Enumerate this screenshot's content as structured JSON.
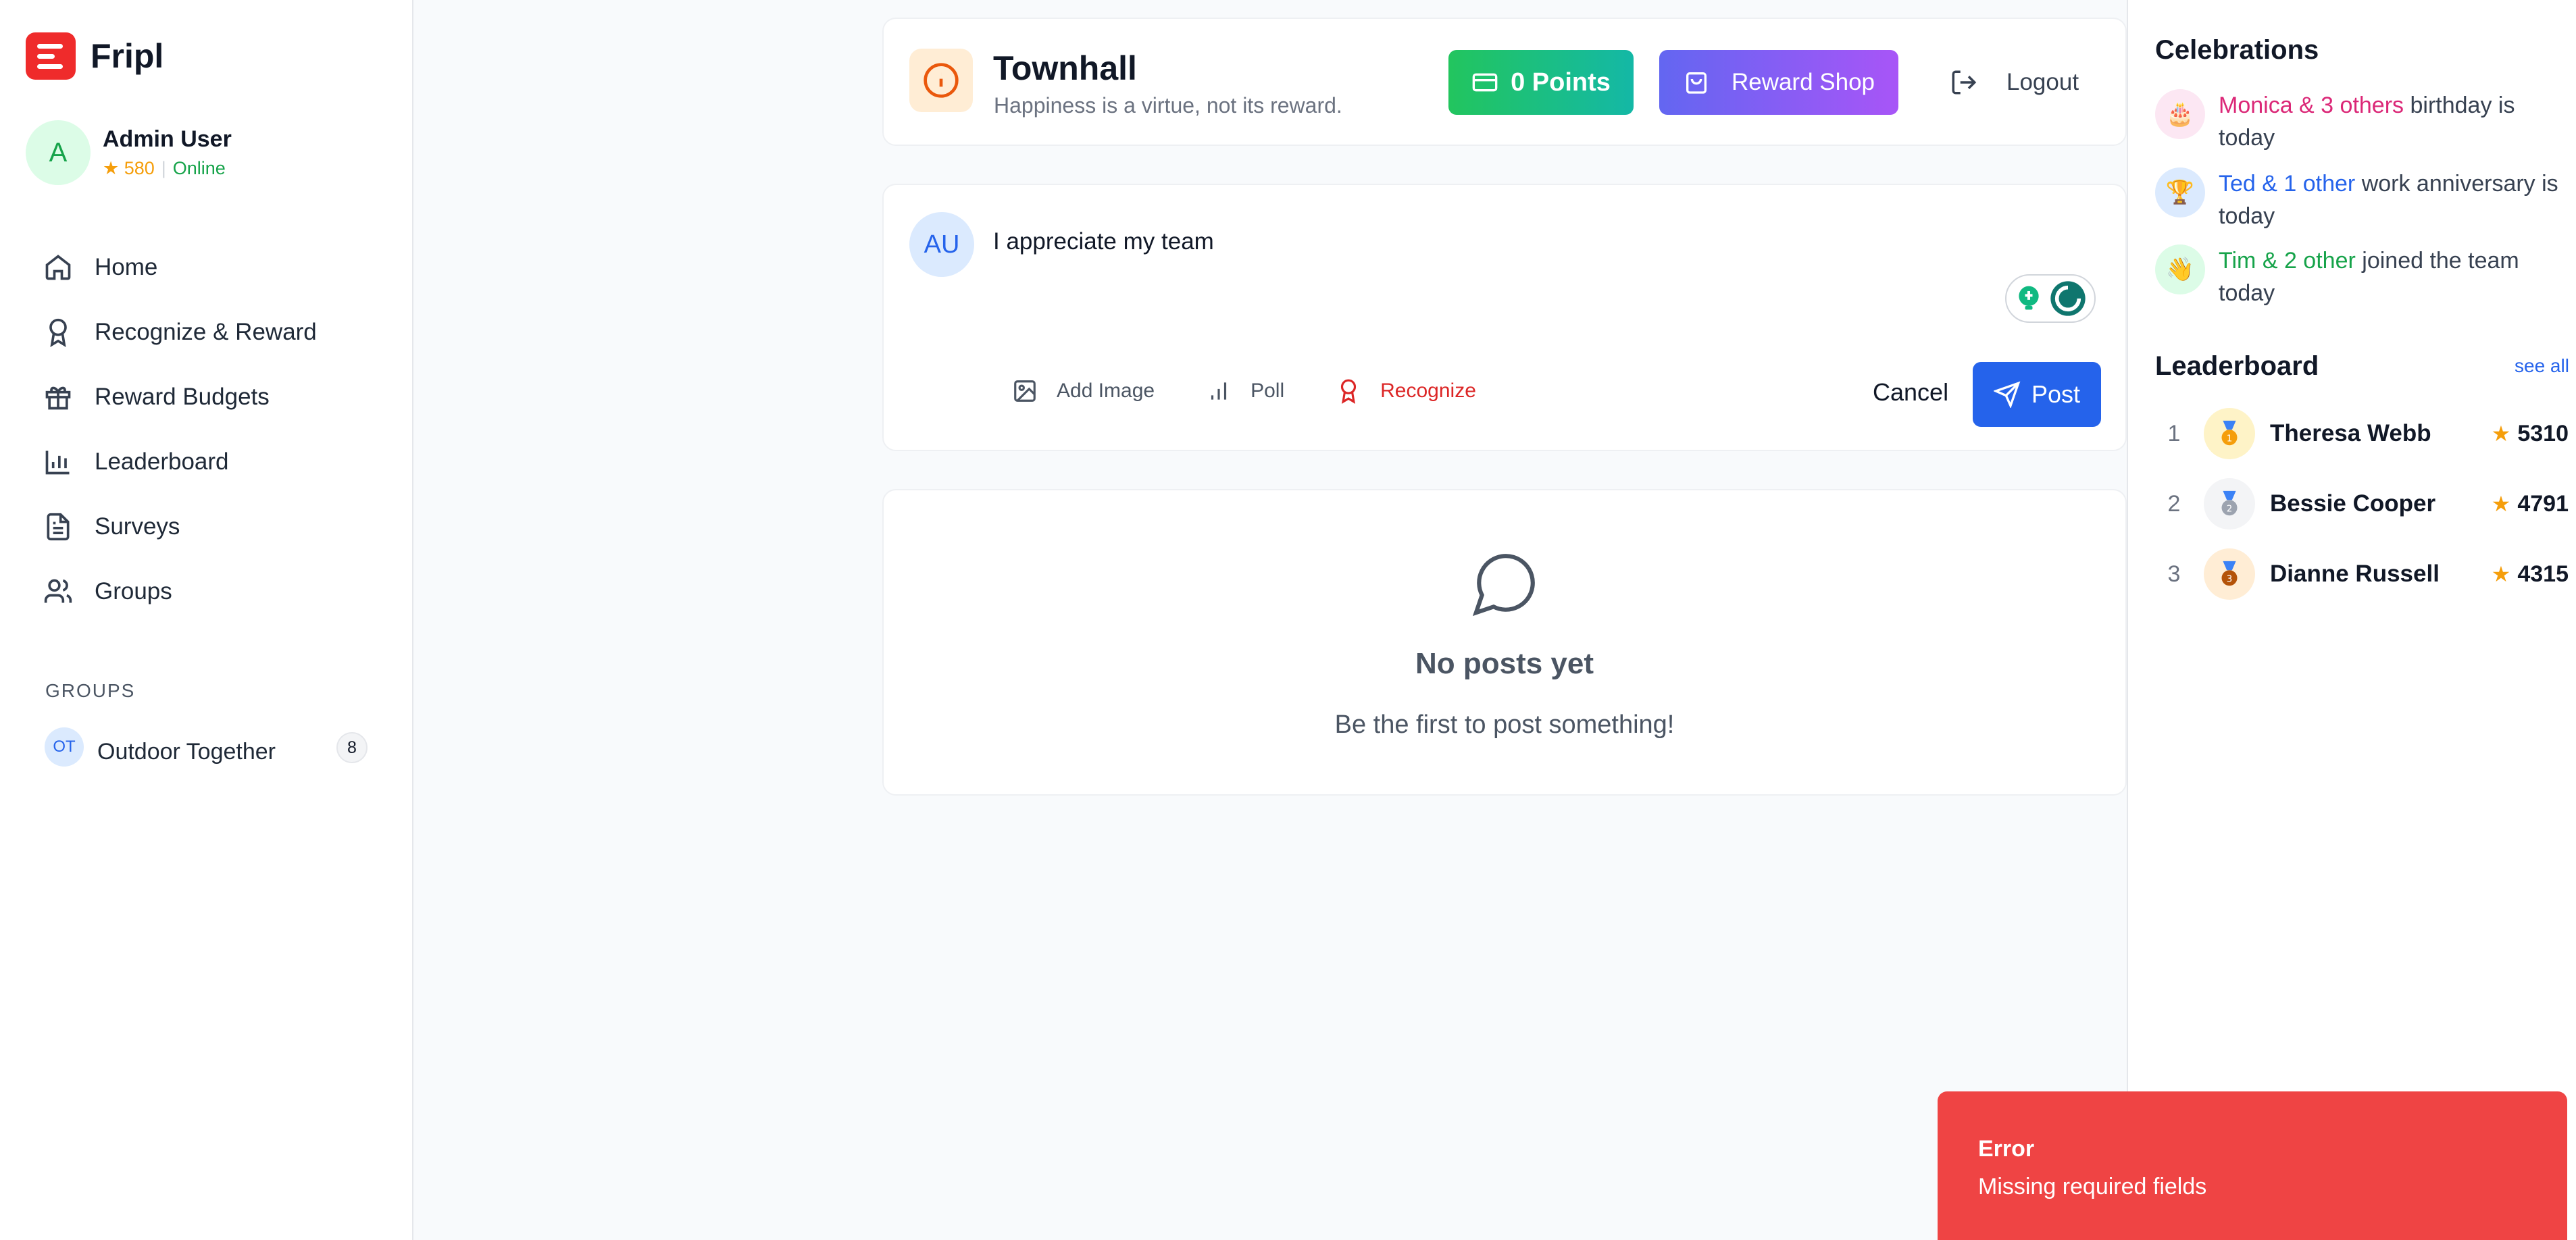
{
  "app": {
    "name": "Fripl"
  },
  "user": {
    "initial": "A",
    "name": "Admin User",
    "points": "★ 580",
    "status": "Online"
  },
  "nav": [
    {
      "label": "Home",
      "icon": "home-icon"
    },
    {
      "label": "Recognize & Reward",
      "icon": "award-icon"
    },
    {
      "label": "Reward Budgets",
      "icon": "gift-icon"
    },
    {
      "label": "Leaderboard",
      "icon": "bar-chart-icon"
    },
    {
      "label": "Surveys",
      "icon": "document-icon"
    },
    {
      "label": "Groups",
      "icon": "users-icon"
    }
  ],
  "groups": {
    "title": "GROUPS",
    "items": [
      {
        "initials": "OT",
        "name": "Outdoor Together",
        "count": "8"
      }
    ]
  },
  "header": {
    "title": "Townhall",
    "subtitle": "Happiness is a virtue, not its reward.",
    "points_label": "0 Points",
    "shop_label": "Reward Shop",
    "logout_label": "Logout"
  },
  "composer": {
    "avatar": "AU",
    "text": "I appreciate my team",
    "actions": {
      "image": "Add Image",
      "poll": "Poll",
      "recognize": "Recognize"
    },
    "cancel": "Cancel",
    "post": "Post"
  },
  "feed": {
    "empty_title": "No posts yet",
    "empty_subtitle": "Be the first to post something!"
  },
  "celebrations": {
    "title": "Celebrations",
    "items": [
      {
        "highlight": "Monica & 3 others",
        "rest": "birthday is today",
        "icon": "cake-icon"
      },
      {
        "highlight": "Ted & 1 other",
        "rest": "work anniversary is today",
        "icon": "trophy-icon"
      },
      {
        "highlight": "Tim & 2 other",
        "rest": "joined the team today",
        "icon": "wave-icon"
      }
    ]
  },
  "leaderboard": {
    "title": "Leaderboard",
    "see_all": "see all",
    "rows": [
      {
        "rank": "1",
        "name": "Theresa Webb",
        "points": "5310",
        "medal": "gold-medal-icon"
      },
      {
        "rank": "2",
        "name": "Bessie Cooper",
        "points": "4791",
        "medal": "silver-medal-icon"
      },
      {
        "rank": "3",
        "name": "Dianne Russell",
        "points": "4315",
        "medal": "bronze-medal-icon"
      }
    ]
  },
  "toast": {
    "title": "Error",
    "message": "Missing required fields"
  },
  "colors": {
    "brand": "#ef2b2b",
    "primary": "#2563eb",
    "error": "#ef4444",
    "success": "#22c55e"
  }
}
